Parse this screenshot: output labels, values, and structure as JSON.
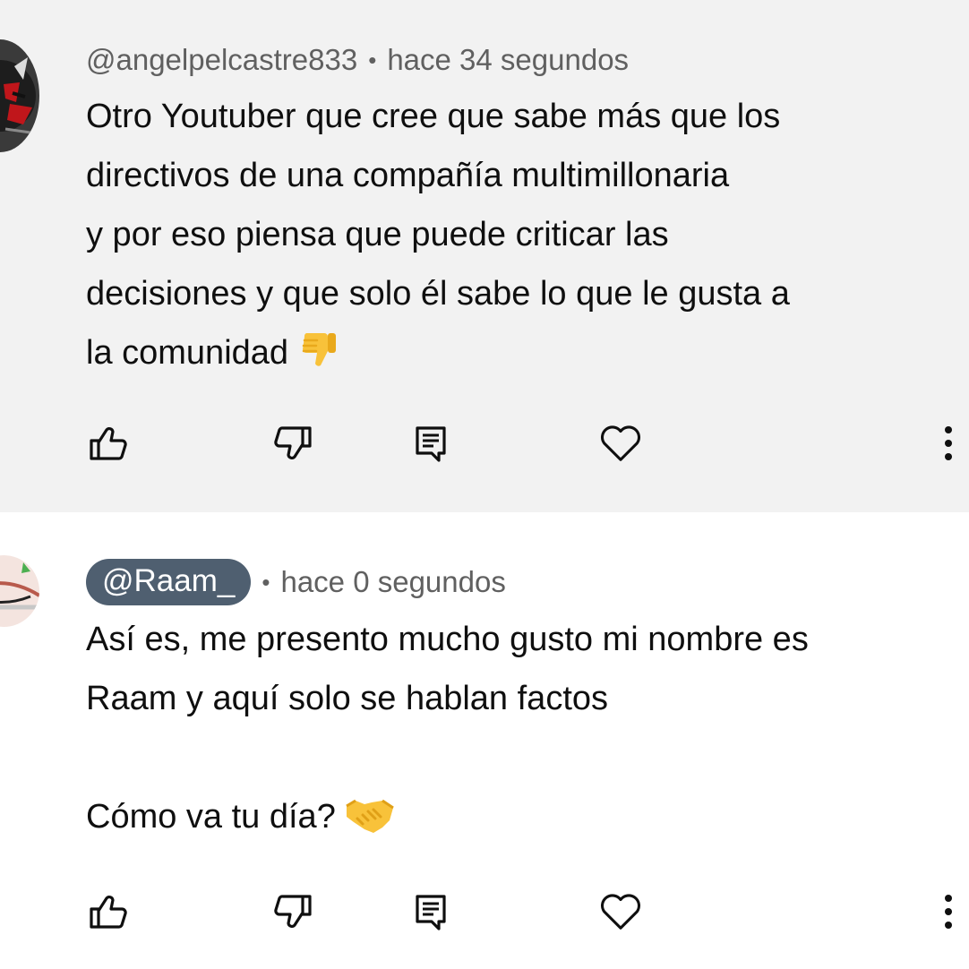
{
  "comments": [
    {
      "handle": "@angelpelcastre833",
      "separator": "•",
      "time": "hace 34 segundos",
      "text": "Otro Youtuber que cree que sabe más que los\ndirectivos de una compañía multimillonaria\ny por eso piensa que puede criticar las\ndecisiones y que solo él sabe lo que le gusta a\nla comunidad",
      "emoji": "thumbs-down-emoji",
      "highlighted": true
    },
    {
      "handle": "@Raam_",
      "separator": "•",
      "time": "hace 0 segundos",
      "text": "Así es, me presento mucho gusto mi nombre es\nRaam y aquí solo se hablan factos\n\nCómo va tu día?",
      "emoji": "handshake-emoji",
      "handle_style": "pill"
    }
  ],
  "actions": [
    "like-icon",
    "dislike-icon",
    "reply-icon",
    "heart-icon",
    "more-vert-icon"
  ],
  "colors": {
    "highlight_bg": "#f2f2f2",
    "meta_text": "#606060",
    "pill_bg": "#4f5f70",
    "emoji_yellow": "#f8c23a"
  }
}
